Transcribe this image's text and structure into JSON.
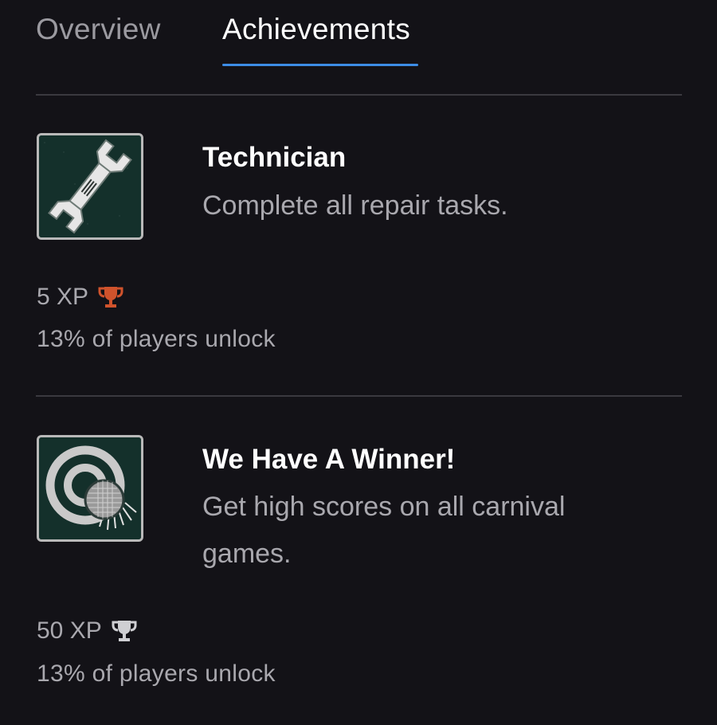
{
  "tabs": [
    {
      "label": "Overview",
      "active": false
    },
    {
      "label": "Achievements",
      "active": true
    }
  ],
  "accent_color": "#3d8de6",
  "achievements": [
    {
      "title": "Technician",
      "description": "Complete all repair tasks.",
      "xp": "5 XP",
      "trophy": "bronze-trophy-icon",
      "trophy_color": "#d0532c",
      "unlock": "13% of players unlock",
      "icon": "wrench-icon"
    },
    {
      "title": "We Have A Winner!",
      "description": "Get high scores on all carnival games.",
      "xp": "50 XP",
      "trophy": "silver-trophy-icon",
      "trophy_color": "#cfcfd3",
      "unlock": "13% of players unlock",
      "icon": "target-ball-icon"
    }
  ]
}
